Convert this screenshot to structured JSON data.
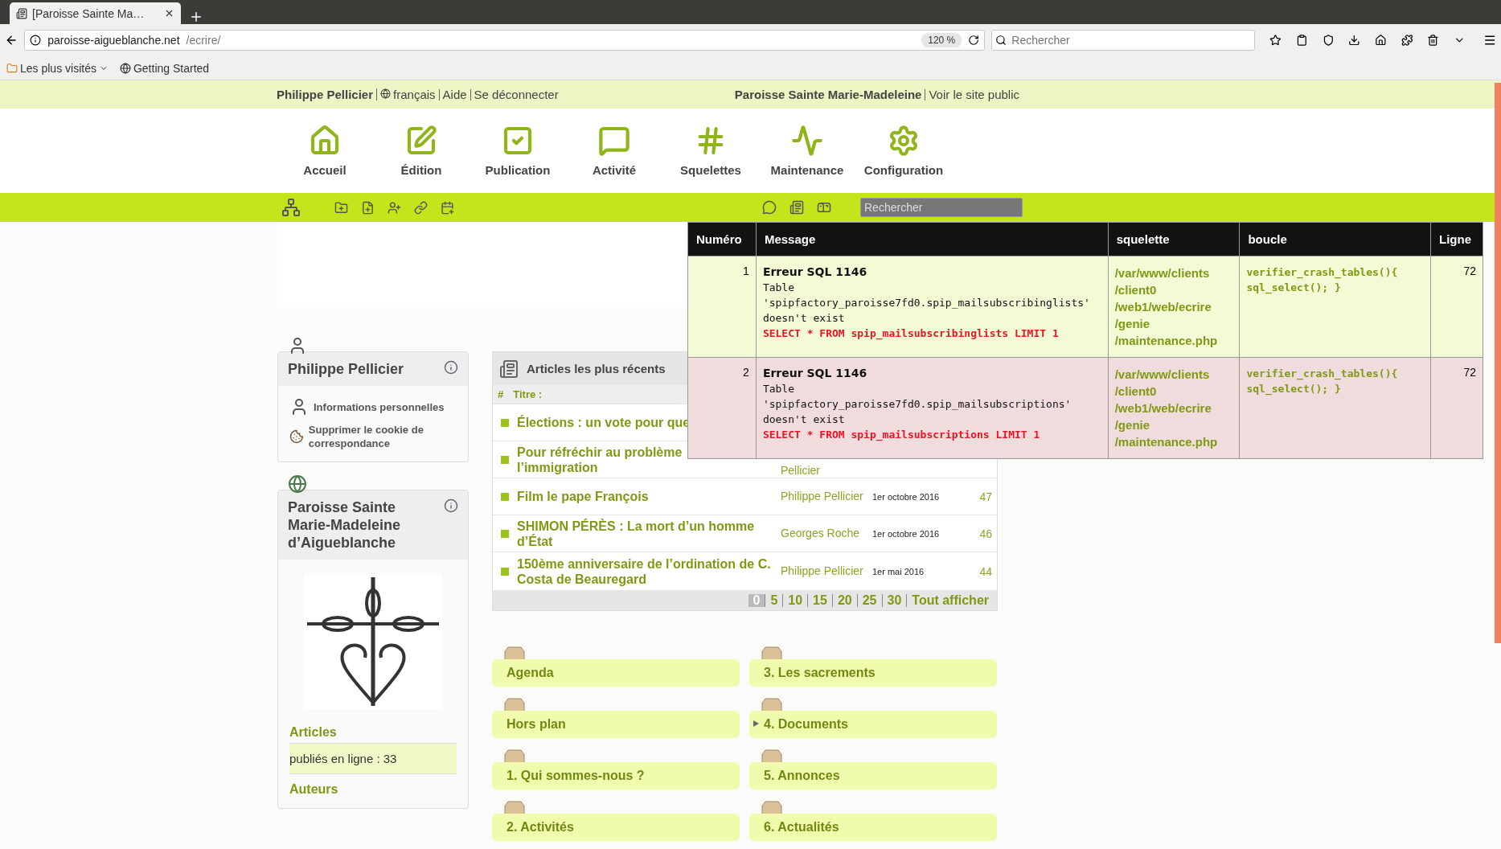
{
  "browser": {
    "tab_title": "[Paroisse Sainte Ma…",
    "url_host": "paroisse-aigueblanche.net",
    "url_path": "/ecrire/",
    "zoom": "120 %",
    "search_placeholder": "Rechercher",
    "bookmarks": [
      "Les plus visités",
      "Getting Started"
    ]
  },
  "top_bar": {
    "user": "Philippe Pellicier",
    "links": [
      "français",
      "Aide",
      "Se déconnecter"
    ],
    "site": "Paroisse Sainte Marie-Madeleine",
    "site_link": "Voir le site public"
  },
  "nav": [
    {
      "label": "Accueil"
    },
    {
      "label": "Édition"
    },
    {
      "label": "Publication"
    },
    {
      "label": "Activité"
    },
    {
      "label": "Squelettes"
    },
    {
      "label": "Maintenance"
    },
    {
      "label": "Configuration"
    }
  ],
  "toolbar": {
    "search_placeholder": "Rechercher"
  },
  "sql_errors": {
    "columns": [
      "Numéro",
      "Message",
      "squelette",
      "boucle",
      "Ligne"
    ],
    "rows": [
      {
        "number": "1",
        "title": "Erreur SQL 1146",
        "message": "Table\n'spipfactory_paroisse7fd0.spip_mailsubscribinglists'\ndoesn't exist",
        "query": "SELECT * FROM spip_mailsubscribinglists LIMIT 1",
        "squelette": "/var/www/clients\n/client0\n/web1/web/ecrire\n/genie\n/maintenance.php",
        "boucle": "verifier_crash_tables(){\nsql_select(); }",
        "line": "72"
      },
      {
        "number": "2",
        "title": "Erreur SQL 1146",
        "message": "Table\n'spipfactory_paroisse7fd0.spip_mailsubscriptions'\ndoesn't exist",
        "query": "SELECT * FROM spip_mailsubscriptions LIMIT 1",
        "squelette": "/var/www/clients\n/client0\n/web1/web/ecrire\n/genie\n/maintenance.php",
        "boucle": "verifier_crash_tables(){\nsql_select(); }",
        "line": "72"
      }
    ]
  },
  "author_box": {
    "title": "Philippe Pellicier",
    "links": [
      "Informations personnelles",
      "Supprimer le cookie de correspondance"
    ]
  },
  "site_box": {
    "title": "Paroisse Sainte Marie-Madeleine d’Aigueblanche",
    "sections": [
      {
        "heading": "Articles",
        "text": "publiés en ligne : 33"
      },
      {
        "heading": "Auteurs"
      }
    ]
  },
  "recent_articles": {
    "title": "Articles les plus récents",
    "columns": [
      "#",
      "Titre :"
    ],
    "rows": [
      {
        "title": "Élections : un vote pour que"
      },
      {
        "title": "Pour réfréchir au problème\nl’immigration",
        "author": "Pellicier"
      },
      {
        "title": "Film le pape François",
        "author": "Philippe Pellicier",
        "date": "1er octobre 2016",
        "number": "47"
      },
      {
        "title": "SHIMON PÉRÈS : La mort d’un homme d’État",
        "author": "Georges Roche",
        "date": "1er octobre 2016",
        "number": "46"
      },
      {
        "title": "150ème anniversaire de l’ordination de C. Costa de Beauregard",
        "author": "Philippe Pellicier",
        "date": "1er mai 2016",
        "number": "44"
      }
    ],
    "pagination": [
      {
        "label": "0",
        "selected": true
      },
      {
        "label": "5",
        "selected": false
      },
      {
        "label": "10",
        "selected": false
      },
      {
        "label": "15",
        "selected": false
      },
      {
        "label": "20",
        "selected": false
      },
      {
        "label": "25",
        "selected": false
      },
      {
        "label": "30",
        "selected": false
      },
      {
        "label": "Tout afficher",
        "selected": false
      }
    ]
  },
  "sections": [
    {
      "label": "Agenda",
      "has_children": false
    },
    {
      "label": "3. Les sacrements",
      "has_children": false
    },
    {
      "label": "Hors plan",
      "has_children": false
    },
    {
      "label": "4. Documents",
      "has_children": true
    },
    {
      "label": "1. Qui sommes-nous ?",
      "has_children": false
    },
    {
      "label": "5. Annonces",
      "has_children": false
    },
    {
      "label": "2. Activités",
      "has_children": false
    },
    {
      "label": "6. Actualités",
      "has_children": false
    }
  ]
}
